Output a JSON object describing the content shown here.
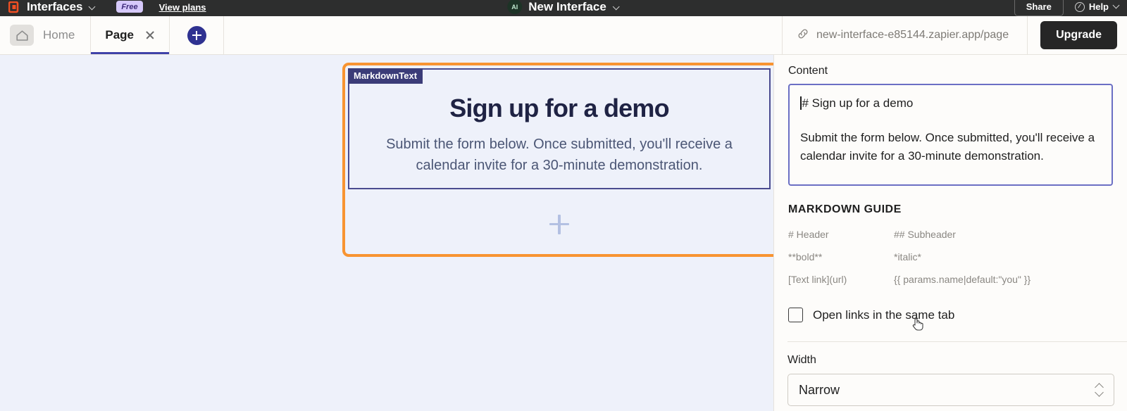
{
  "topbar": {
    "logo_icon": "zapier-logo-icon",
    "brand": "Interfaces",
    "brand_chevron_icon": "chevron-down-icon",
    "plan_badge": "Free",
    "view_plans": "View plans",
    "ai_badge": "AI",
    "interface_name": "New Interface",
    "interface_chevron_icon": "chevron-down-icon",
    "share_label": "Share",
    "help_icon": "help-circle-icon",
    "help_label": "Help",
    "help_chevron_icon": "chevron-down-icon",
    "bar_color": "#2d2e2e"
  },
  "tabbar": {
    "home_icon": "home-icon",
    "home_label": "Home",
    "page_label": "Page",
    "close_icon": "close-icon",
    "add_tab_icon": "plus-circle-icon",
    "link_icon": "link-icon",
    "url": "new-interface-e85144.zapier.app/page",
    "upgrade_label": "Upgrade",
    "active_tab_color": "#3f42a8"
  },
  "canvas": {
    "selection_color": "#f89431",
    "block_tag": "MarkdownText",
    "heading": "Sign up for a demo",
    "paragraph": "Submit the form below. Once submitted, you'll receive a calendar invite for a 30-minute demonstration.",
    "add_block_icon": "plus-icon",
    "background": "#eef1fa"
  },
  "panel": {
    "content_label": "Content",
    "content_lines": [
      "# Sign up for a demo",
      "Submit the form below. Once submitted, you'll receive a calendar invite for a 30-minute demonstration."
    ],
    "focus_border_color": "#6b6fc4",
    "guide_title": "MARKDOWN GUIDE",
    "guide_items": [
      "# Header",
      "## Subheader",
      "**bold**",
      "*italic*",
      "[Text link](url)",
      "{{ params.name|default:\"you\" }}"
    ],
    "checkbox_label": "Open links in the same tab",
    "checkbox_checked": false,
    "width_label": "Width",
    "width_value": "Narrow",
    "width_stepper_icon": "chevron-updown-icon",
    "cursor_icon": "pointer-hand-cursor"
  }
}
